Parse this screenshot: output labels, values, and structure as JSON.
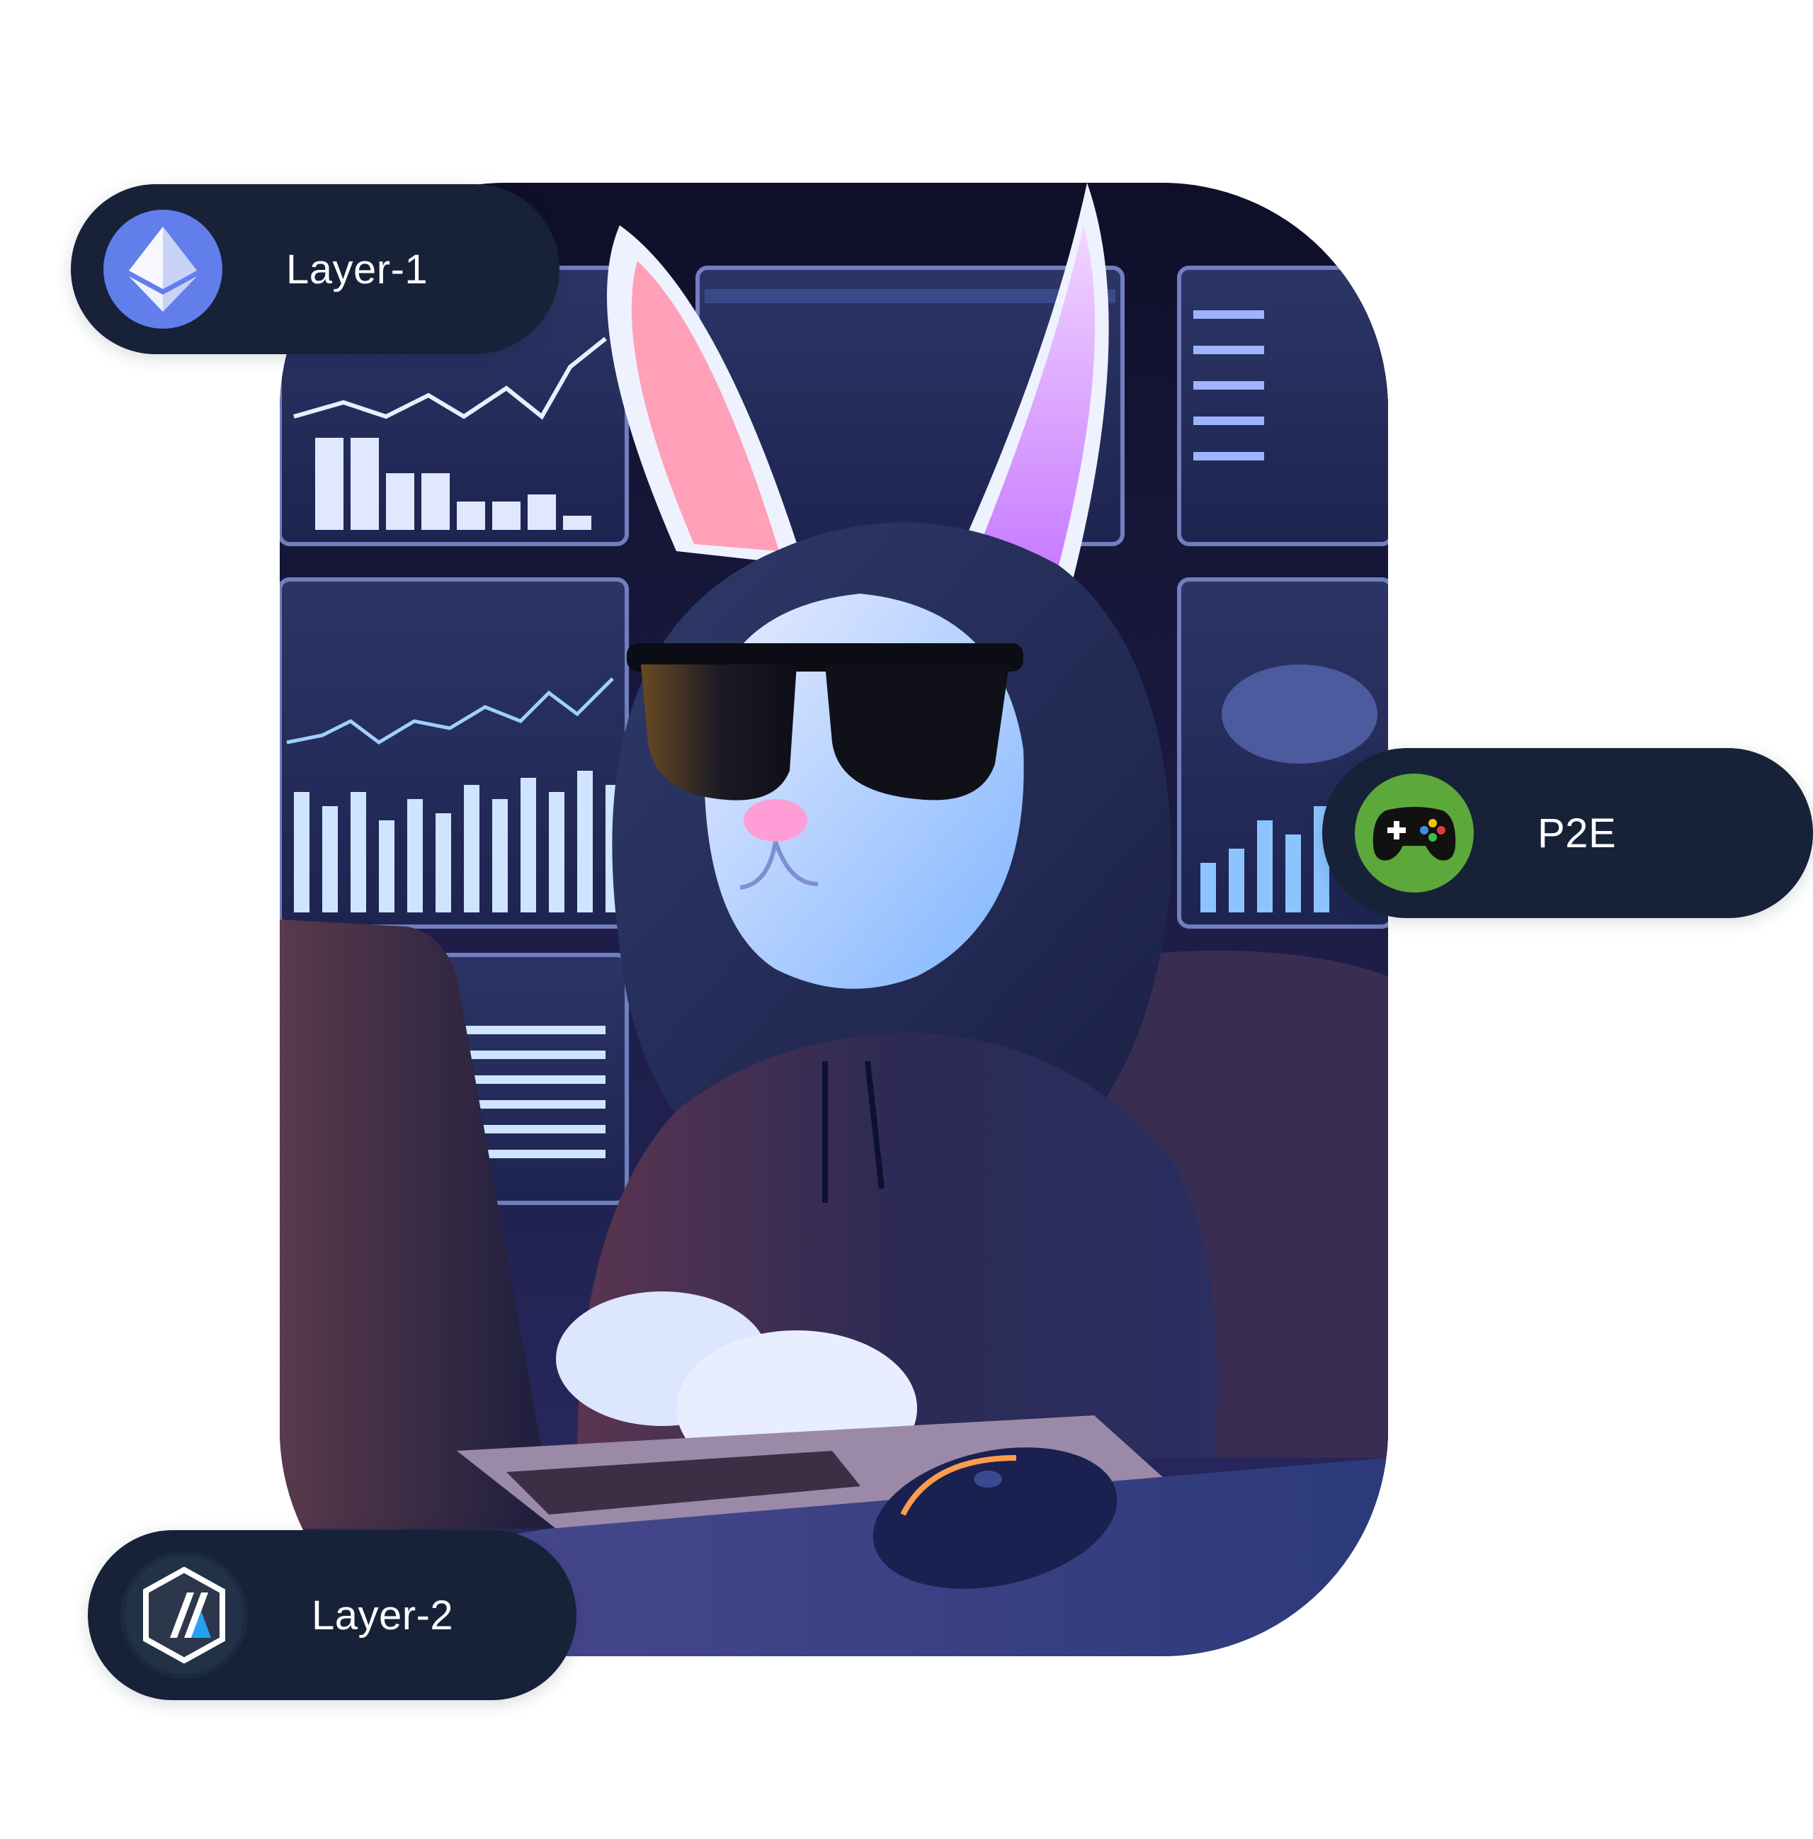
{
  "hero": {
    "description_icon": "hooded-rabbit-trader-illustration"
  },
  "pills": {
    "layer1": {
      "label": "Layer-1",
      "icon": "ethereum-icon",
      "icon_color": "#627eea"
    },
    "p2e": {
      "label": "P2E",
      "icon": "gamepad-icon",
      "icon_color": "#5da83a"
    },
    "layer2": {
      "label": "Layer-2",
      "icon": "arbitrum-icon",
      "icon_color": "#213147"
    }
  },
  "colors": {
    "pill_background": "#172238",
    "pill_text": "#ffffff",
    "page_background": "#ffffff"
  }
}
